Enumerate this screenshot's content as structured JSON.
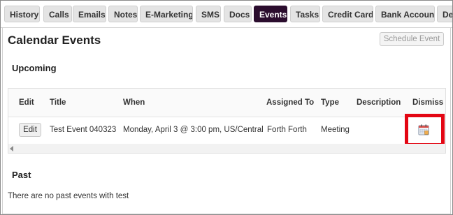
{
  "tabs": [
    {
      "label": "History"
    },
    {
      "label": "Calls"
    },
    {
      "label": "Emails"
    },
    {
      "label": "Notes"
    },
    {
      "label": "E-Marketing"
    },
    {
      "label": "SMS"
    },
    {
      "label": "Docs"
    },
    {
      "label": "Events",
      "active": true
    },
    {
      "label": "Tasks"
    },
    {
      "label": "Credit Card"
    },
    {
      "label": "Bank Account"
    },
    {
      "label": "De"
    }
  ],
  "page": {
    "title": "Calendar Events",
    "schedule_button": "Schedule Event"
  },
  "upcoming": {
    "title": "Upcoming",
    "headers": {
      "edit": "Edit",
      "title": "Title",
      "when": "When",
      "assigned_to": "Assigned To",
      "type": "Type",
      "description": "Description",
      "dismiss": "Dismiss"
    },
    "rows": [
      {
        "edit_label": "Edit",
        "title": "Test Event 040323",
        "when": "Monday, April 3 @ 3:00 pm, US/Central",
        "assigned_to": "Forth Forth",
        "type": "Meeting",
        "description": "",
        "dismiss_icon": "calendar-dismiss-icon"
      }
    ]
  },
  "past": {
    "title": "Past",
    "empty_message": "There are no past events with test"
  },
  "colors": {
    "active_tab": "#2b0d2e",
    "highlight": "#e30613"
  }
}
